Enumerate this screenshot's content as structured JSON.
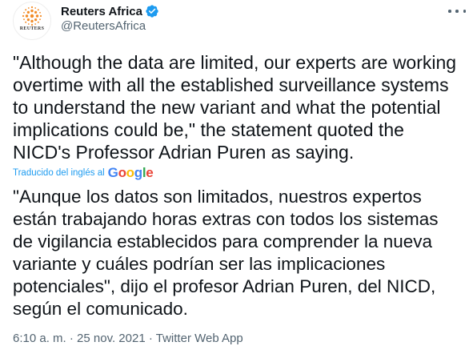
{
  "author": {
    "avatar_text": "REUTERS",
    "display_name": "Reuters Africa",
    "handle": "@ReutersAfrica",
    "verified": true
  },
  "tweet": {
    "text": "\"Although the data are limited, our experts are working\novertime with all the established surveillance systems\nto understand the new variant and what the potential\nimplications could be,\" the statement quoted the\nNICD's Professor Adrian Puren as saying.",
    "translated_label": "Traducido del inglés al",
    "translated_logo": [
      "G",
      "o",
      "o",
      "g",
      "l",
      "e"
    ],
    "translation": "\"Aunque los datos son limitados, nuestros expertos\nestán trabajando horas extras con todos los sistemas\nde vigilancia establecidos para comprender la nueva\nvariante y cuáles podrían ser las implicaciones\npotenciales\", dijo el profesor Adrian Puren, del NICD,\nsegún el comunicado."
  },
  "meta": {
    "time": "6:10 a. m.",
    "separator": "·",
    "date": "25 nov. 2021",
    "source": "Twitter Web App"
  },
  "colors": {
    "accent": "#1d9bf0",
    "text": "#0f1419",
    "secondary": "#536471",
    "reuters_orange": "#f28c28"
  },
  "icons": {
    "verified": "verified-badge-icon",
    "more": "more-options-icon"
  }
}
